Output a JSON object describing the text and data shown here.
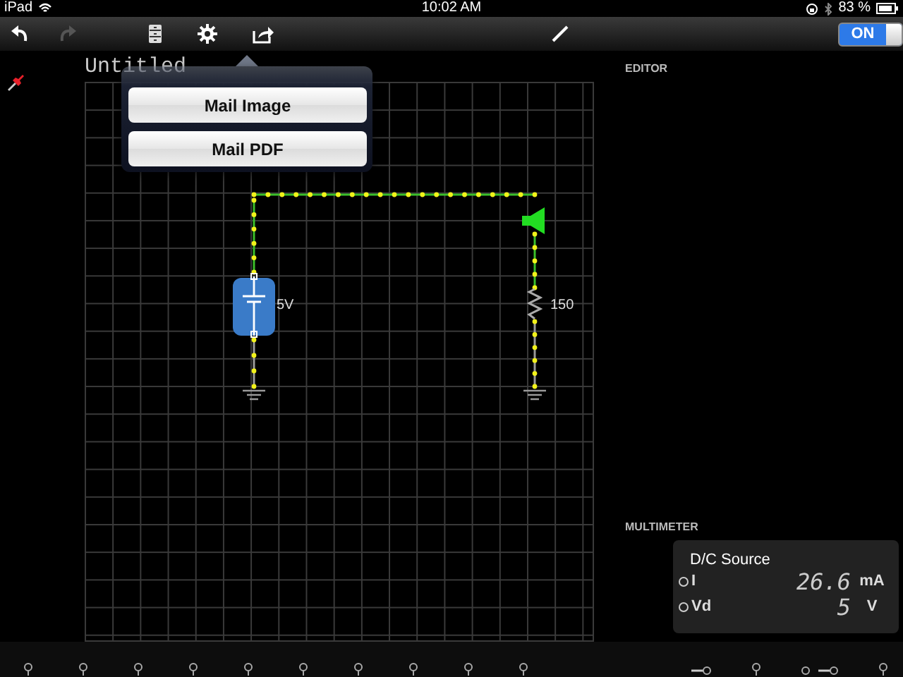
{
  "status_bar": {
    "carrier": "iPad",
    "time": "10:02 AM",
    "battery": "83 %"
  },
  "toolbar": {
    "toggle": {
      "label": "ON",
      "on": true
    }
  },
  "document": {
    "title": "Untitled"
  },
  "share_menu": {
    "items": [
      "Mail Image",
      "Mail PDF"
    ]
  },
  "circuit": {
    "powered": true,
    "components": [
      {
        "kind": "battery",
        "label": "5V",
        "selected": true
      },
      {
        "kind": "resistor",
        "label": "150",
        "selected": false
      }
    ]
  },
  "editor": {
    "heading": "EDITOR"
  },
  "multimeter": {
    "heading": "MULTIMETER",
    "source": "D/C Source",
    "readings": [
      {
        "name": "I",
        "value": "26.6",
        "unit": "mA"
      },
      {
        "name": "Vd",
        "value": "5",
        "unit": "V"
      }
    ]
  },
  "palette": {
    "left": [
      {
        "kind": "probe"
      },
      {
        "kind": "probe"
      },
      {
        "kind": "probe"
      },
      {
        "kind": "probe"
      },
      {
        "kind": "probe"
      },
      {
        "kind": "probe"
      },
      {
        "kind": "probe"
      },
      {
        "kind": "probe"
      },
      {
        "kind": "probe"
      },
      {
        "kind": "probe"
      }
    ],
    "right": [
      {
        "kind": "lead"
      },
      {
        "kind": "probe"
      },
      {
        "kind": "switch"
      },
      {
        "kind": "probe"
      }
    ]
  }
}
